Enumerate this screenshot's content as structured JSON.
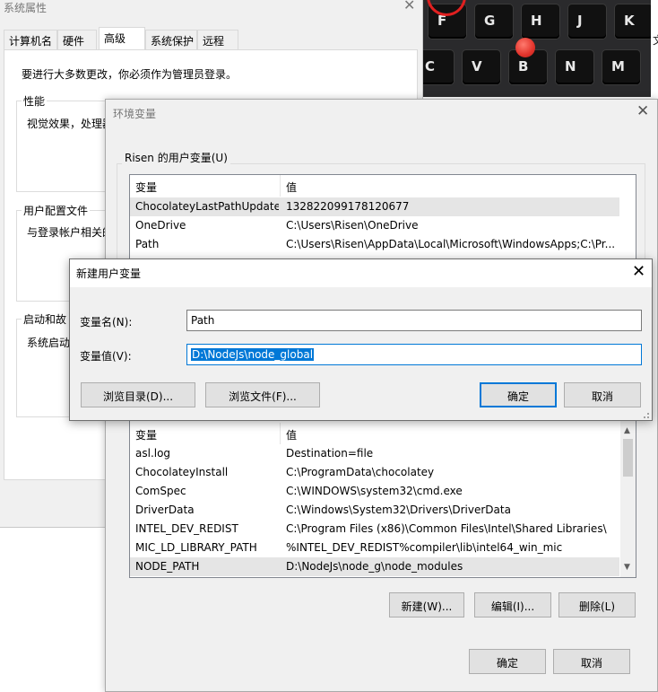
{
  "keyboard": {
    "row1": [
      "F",
      "G",
      "H",
      "J",
      "K"
    ],
    "row2": [
      "C",
      "V",
      "B",
      "N",
      "M"
    ],
    "edge_text": "文"
  },
  "sysprops": {
    "title": "系统属性",
    "tabs": [
      "计算机名",
      "硬件",
      "高级",
      "系统保护",
      "远程"
    ],
    "active_tab": "高级",
    "admin_notice": "要进行大多数更改，你必须作为管理员登录。",
    "groups": [
      {
        "label": "性能",
        "text": "视觉效果，处理器"
      },
      {
        "label": "用户配置文件",
        "text": "与登录帐户相关的"
      },
      {
        "label": "启动和故",
        "text": "系统启动"
      }
    ]
  },
  "env": {
    "title": "环境变量",
    "user_section_label": "Risen 的用户变量(U)",
    "col_variable": "变量",
    "col_value": "值",
    "user_vars": [
      {
        "name": "ChocolateyLastPathUpdate",
        "value": "132822099178120677",
        "selected": true
      },
      {
        "name": "OneDrive",
        "value": "C:\\Users\\Risen\\OneDrive",
        "selected": false
      },
      {
        "name": "Path",
        "value": "C:\\Users\\Risen\\AppData\\Local\\Microsoft\\WindowsApps;C:\\Pr...",
        "selected": false
      }
    ],
    "system_vars": [
      {
        "name": "asl.log",
        "value": "Destination=file",
        "selected": false
      },
      {
        "name": "ChocolateyInstall",
        "value": "C:\\ProgramData\\chocolatey",
        "selected": false
      },
      {
        "name": "ComSpec",
        "value": "C:\\WINDOWS\\system32\\cmd.exe",
        "selected": false
      },
      {
        "name": "DriverData",
        "value": "C:\\Windows\\System32\\Drivers\\DriverData",
        "selected": false
      },
      {
        "name": "INTEL_DEV_REDIST",
        "value": "C:\\Program Files (x86)\\Common Files\\Intel\\Shared Libraries\\",
        "selected": false
      },
      {
        "name": "MIC_LD_LIBRARY_PATH",
        "value": "%INTEL_DEV_REDIST%compiler\\lib\\intel64_win_mic",
        "selected": false
      },
      {
        "name": "NODE_PATH",
        "value": "D:\\NodeJs\\node_g\\node_modules",
        "selected": true
      }
    ],
    "btn_new": "新建(W)...",
    "btn_edit": "编辑(I)...",
    "btn_delete": "删除(L)",
    "btn_ok": "确定",
    "btn_cancel": "取消"
  },
  "newvar": {
    "title": "新建用户变量",
    "name_label": "变量名(N):",
    "name_value": "Path",
    "value_label": "变量值(V):",
    "value_value": "D:\\NodeJs\\node_global",
    "btn_browse_dir": "浏览目录(D)...",
    "btn_browse_file": "浏览文件(F)...",
    "btn_ok": "确定",
    "btn_cancel": "取消"
  },
  "colors": {
    "accent": "#0078d7",
    "selected_row": "#e5e5e5",
    "window_bg": "#f0f0f0"
  }
}
